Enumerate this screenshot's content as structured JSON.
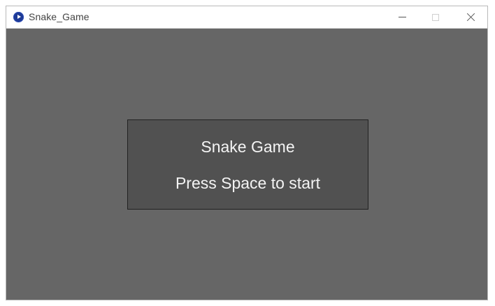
{
  "window": {
    "title": "Snake_Game",
    "icon": "app-play-icon",
    "controls": {
      "minimize": "minimize-icon",
      "maximize": "maximize-icon",
      "close": "close-icon"
    }
  },
  "game": {
    "background_color": "#666666",
    "dialog_color": "#515151",
    "dialog": {
      "title": "Snake Game",
      "message": "Press Space to start"
    }
  }
}
